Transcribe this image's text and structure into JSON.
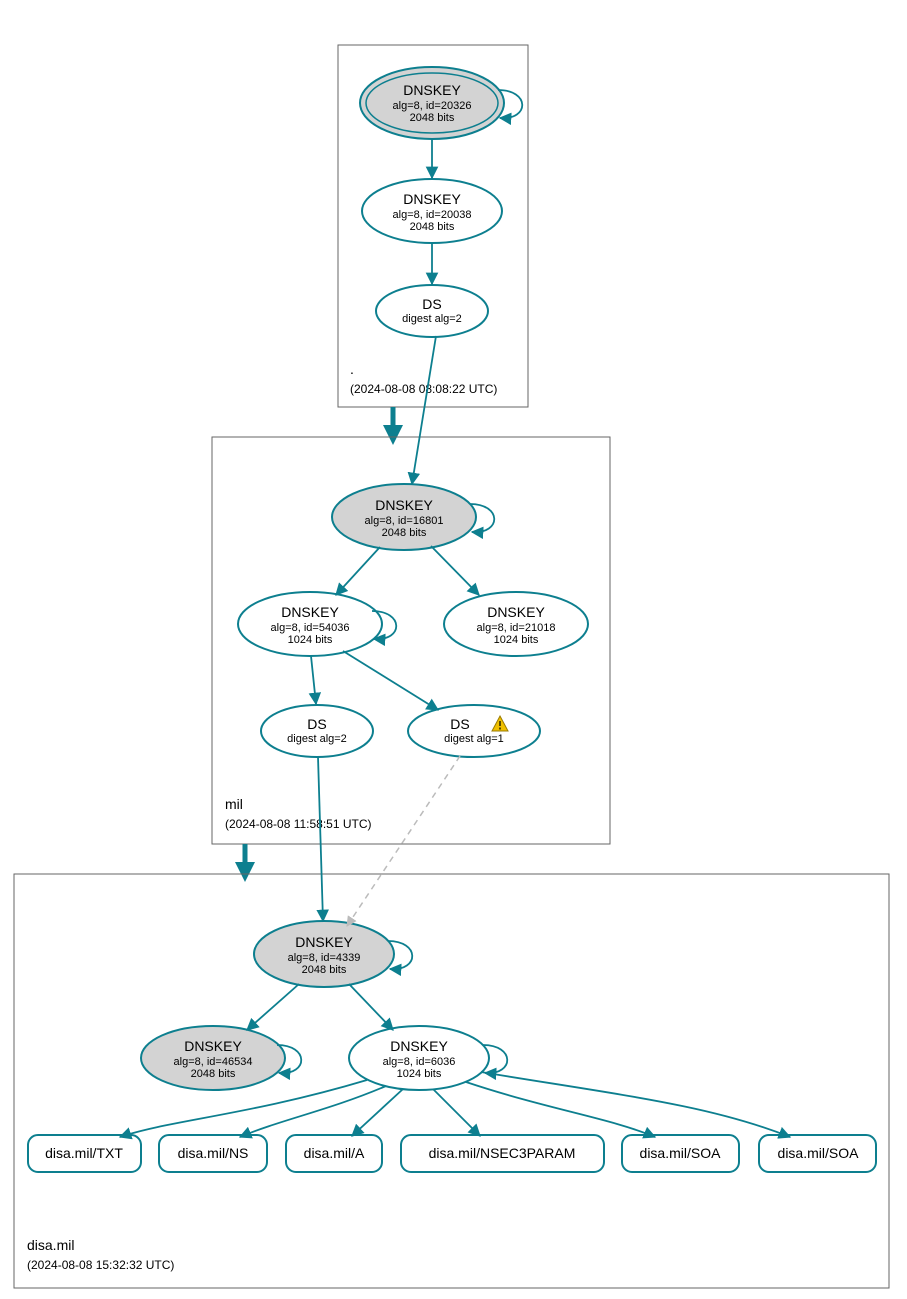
{
  "chart_data": {
    "type": "graph",
    "zones": [
      {
        "name": ".",
        "timestamp": "(2024-08-08 08:08:22 UTC)"
      },
      {
        "name": "mil",
        "timestamp": "(2024-08-08 11:58:51 UTC)"
      },
      {
        "name": "disa.mil",
        "timestamp": "(2024-08-08 15:32:32 UTC)"
      }
    ],
    "nodes": {
      "root_ksk": {
        "title": "DNSKEY",
        "line2": "alg=8, id=20326",
        "line3": "2048 bits",
        "sep": true,
        "double": true
      },
      "root_zsk": {
        "title": "DNSKEY",
        "line2": "alg=8, id=20038",
        "line3": "2048 bits",
        "sep": false,
        "double": false
      },
      "root_ds": {
        "title": "DS",
        "line2": "digest alg=2",
        "line3": "",
        "sep": false,
        "double": false
      },
      "mil_ksk": {
        "title": "DNSKEY",
        "line2": "alg=8, id=16801",
        "line3": "2048 bits",
        "sep": true,
        "double": false
      },
      "mil_zsk1": {
        "title": "DNSKEY",
        "line2": "alg=8, id=54036",
        "line3": "1024 bits",
        "sep": false,
        "double": false
      },
      "mil_zsk2": {
        "title": "DNSKEY",
        "line2": "alg=8, id=21018",
        "line3": "1024 bits",
        "sep": false,
        "double": false
      },
      "mil_ds1": {
        "title": "DS",
        "line2": "digest alg=2",
        "line3": "",
        "sep": false,
        "double": false
      },
      "mil_ds2": {
        "title": "DS",
        "line2": "digest alg=1",
        "line3": "",
        "sep": false,
        "double": false,
        "warn": true
      },
      "disa_ksk": {
        "title": "DNSKEY",
        "line2": "alg=8, id=4339",
        "line3": "2048 bits",
        "sep": true,
        "double": false
      },
      "disa_key2": {
        "title": "DNSKEY",
        "line2": "alg=8, id=46534",
        "line3": "2048 bits",
        "sep": true,
        "double": false
      },
      "disa_zsk": {
        "title": "DNSKEY",
        "line2": "alg=8, id=6036",
        "line3": "1024 bits",
        "sep": false,
        "double": false
      }
    },
    "records": [
      "disa.mil/TXT",
      "disa.mil/NS",
      "disa.mil/A",
      "disa.mil/NSEC3PARAM",
      "disa.mil/SOA",
      "disa.mil/SOA"
    ]
  }
}
